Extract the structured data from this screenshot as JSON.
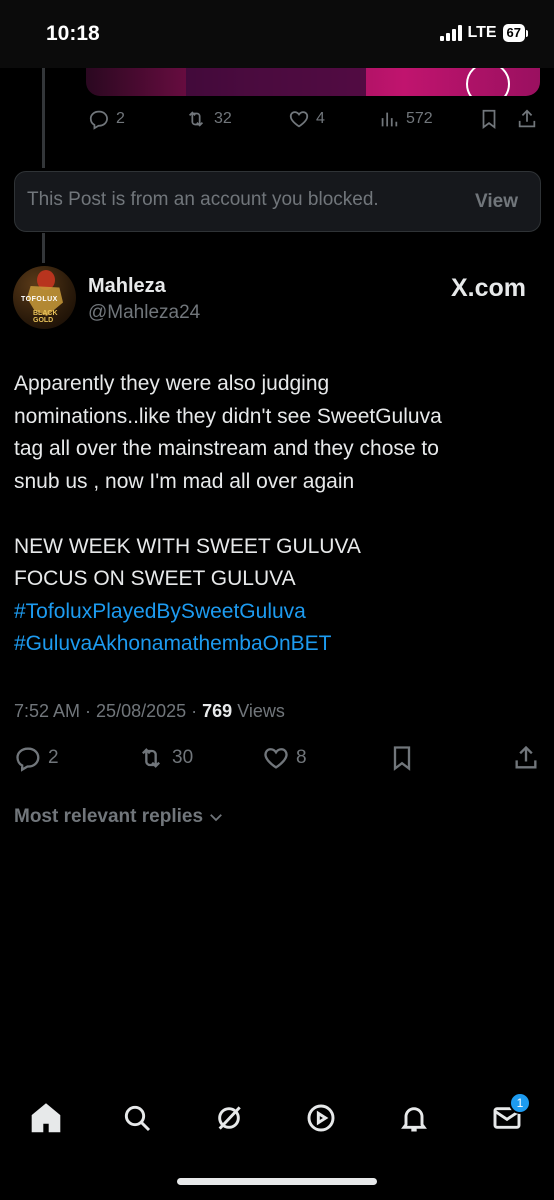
{
  "status_bar": {
    "time": "10:18",
    "network": "LTE",
    "battery": "67"
  },
  "previous_post": {
    "actions": {
      "replies": "2",
      "reposts": "32",
      "likes": "4",
      "views": "572"
    }
  },
  "blocked_notice": {
    "text": "This Post is from an account you blocked.",
    "view_label": "View"
  },
  "post": {
    "author": {
      "name": "Mahleza",
      "handle": "@Mahleza24",
      "avatar_text_top": "TOFOLUX",
      "avatar_text_bottom": "BLACK GOLD"
    },
    "source_badge": "X.com",
    "body": {
      "line1": "Apparently they were also judging",
      "line2": "nominations..like they didn't see SweetGuluva",
      "line3": "tag all over the mainstream and they chose to",
      "line4": "snub us , now I'm mad all over again",
      "line5": "NEW WEEK WITH SWEET GULUVA",
      "line6": "FOCUS ON SWEET GULUVA",
      "hashtag1": "#TofoluxPlayedBySweetGuluva",
      "hashtag2": "#GuluvaAkhonamathembaOnBET"
    },
    "meta": {
      "time": "7:52 AM",
      "date": "25/08/2025",
      "views_count": "769",
      "views_label": "Views"
    },
    "actions": {
      "replies": "2",
      "reposts": "30",
      "likes": "8"
    }
  },
  "replies_sort_label": "Most relevant replies",
  "bottom_nav": {
    "items": [
      "home",
      "search",
      "grok",
      "video",
      "notifications",
      "messages"
    ],
    "messages_badge": "1"
  },
  "colors": {
    "background": "#000000",
    "text_primary": "#e7e9ea",
    "text_secondary": "#71767b",
    "accent": "#1d9bf0",
    "card_background": "#16181c"
  }
}
